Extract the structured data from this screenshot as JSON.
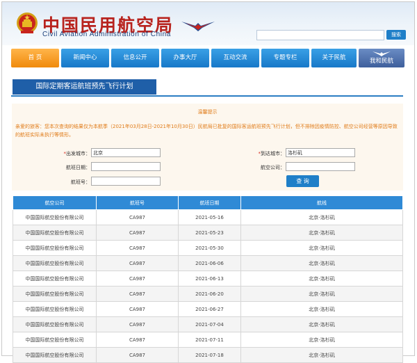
{
  "site": {
    "title_cn": "中国民用航空局",
    "title_en": "Civil Aviation Administration of China",
    "search_button": "搜索"
  },
  "nav": {
    "items": [
      {
        "label": "首 页"
      },
      {
        "label": "新闻中心"
      },
      {
        "label": "信息公开"
      },
      {
        "label": "办事大厅"
      },
      {
        "label": "互动交流"
      },
      {
        "label": "专题专栏"
      },
      {
        "label": "关于民航"
      },
      {
        "label": "我和民航"
      }
    ]
  },
  "section": {
    "title": "国际定期客运航班预先飞行计划"
  },
  "notice": {
    "title": "温馨提示",
    "body": "亲爱的旅客：您本次查询的结果仅为本航季（2021年03月28日-2021年10月30日）民航局已批复的国际客运航班预先飞行计划，但不排除因疫情防控、航空公司经营等原因导致的航班实际未执行等情形。"
  },
  "form": {
    "dep_label_req": "*",
    "dep_label": "出发城市：",
    "dep_value": "北京",
    "arr_label_req": "*",
    "arr_label": "到达城市：",
    "arr_value": "洛杉矶",
    "date_label": "航班日期：",
    "date_value": "",
    "airline_label": "航空公司：",
    "airline_value": "",
    "flightno_label": "航班号：",
    "flightno_value": "",
    "query_button": "查 询"
  },
  "table": {
    "columns": [
      "航空公司",
      "航班号",
      "航班日期",
      "航线"
    ],
    "rows": [
      [
        "中国国际航空股份有限公司",
        "CA987",
        "2021-05-16",
        "北京-洛杉矶"
      ],
      [
        "中国国际航空股份有限公司",
        "CA987",
        "2021-05-23",
        "北京-洛杉矶"
      ],
      [
        "中国国际航空股份有限公司",
        "CA987",
        "2021-05-30",
        "北京-洛杉矶"
      ],
      [
        "中国国际航空股份有限公司",
        "CA987",
        "2021-06-06",
        "北京-洛杉矶"
      ],
      [
        "中国国际航空股份有限公司",
        "CA987",
        "2021-06-13",
        "北京-洛杉矶"
      ],
      [
        "中国国际航空股份有限公司",
        "CA987",
        "2021-06-20",
        "北京-洛杉矶"
      ],
      [
        "中国国际航空股份有限公司",
        "CA987",
        "2021-06-27",
        "北京-洛杉矶"
      ],
      [
        "中国国际航空股份有限公司",
        "CA987",
        "2021-07-04",
        "北京-洛杉矶"
      ],
      [
        "中国国际航空股份有限公司",
        "CA987",
        "2021-07-11",
        "北京-洛杉矶"
      ],
      [
        "中国国际航空股份有限公司",
        "CA987",
        "2021-07-18",
        "北京-洛杉矶"
      ]
    ]
  },
  "colors": {
    "brand_red": "#b8231e",
    "nav_blue": "#1778c8",
    "nav_active_orange": "#f08a0c",
    "section_blue": "#1f5fa8",
    "notice_orange": "#e07b18",
    "table_header_blue": "#2f8ad6"
  },
  "icons": {
    "emblem": "national-emblem-icon",
    "logo": "caac-wings-logo-icon"
  }
}
